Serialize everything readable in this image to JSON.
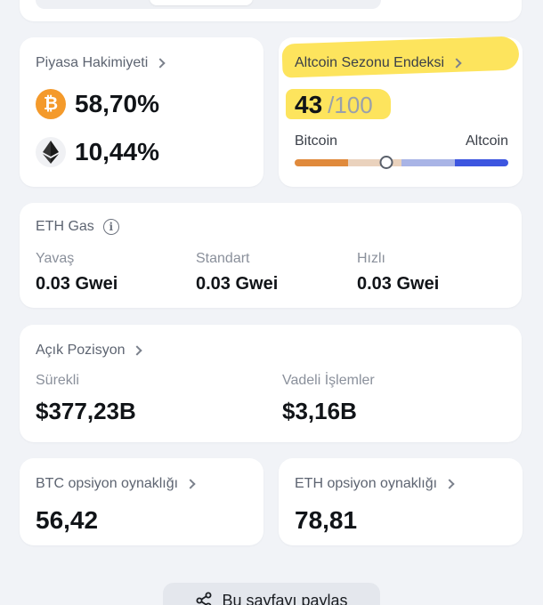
{
  "dominance": {
    "title": "Piyasa Hakimiyeti",
    "btc": {
      "symbol": "₿",
      "icon": "bitcoin-icon",
      "value": "58,70%"
    },
    "eth": {
      "icon": "ethereum-icon",
      "value": "10,44%"
    }
  },
  "altseason": {
    "title": "Altcoin Sezonu Endeksi",
    "score": "43",
    "max": "/100",
    "left_label": "Bitcoin",
    "right_label": "Altcoin",
    "level": 0.43,
    "bar_colors": [
      "#e08a3c",
      "#ead2bd",
      "#a9b4e6",
      "#3d56e0"
    ],
    "highlight_color": "#fde24f"
  },
  "gas": {
    "title": "ETH Gas",
    "info_symbol": "i",
    "columns": [
      {
        "label": "Yavaş",
        "value": "0.03 Gwei"
      },
      {
        "label": "Standart",
        "value": "0.03 Gwei"
      },
      {
        "label": "Hızlı",
        "value": "0.03 Gwei"
      }
    ]
  },
  "open_interest": {
    "title": "Açık Pozisyon",
    "columns": [
      {
        "label": "Sürekli",
        "value": "$377,23B"
      },
      {
        "label": "Vadeli İşlemler",
        "value": "$3,16B"
      }
    ]
  },
  "btc_vol": {
    "title": "BTC opsiyon oynaklığı",
    "value": "56,42"
  },
  "eth_vol": {
    "title": "ETH opsiyon oynaklığı",
    "value": "78,81"
  },
  "share": {
    "label": "Bu sayfayı paylaş",
    "icon": "share-icon"
  }
}
